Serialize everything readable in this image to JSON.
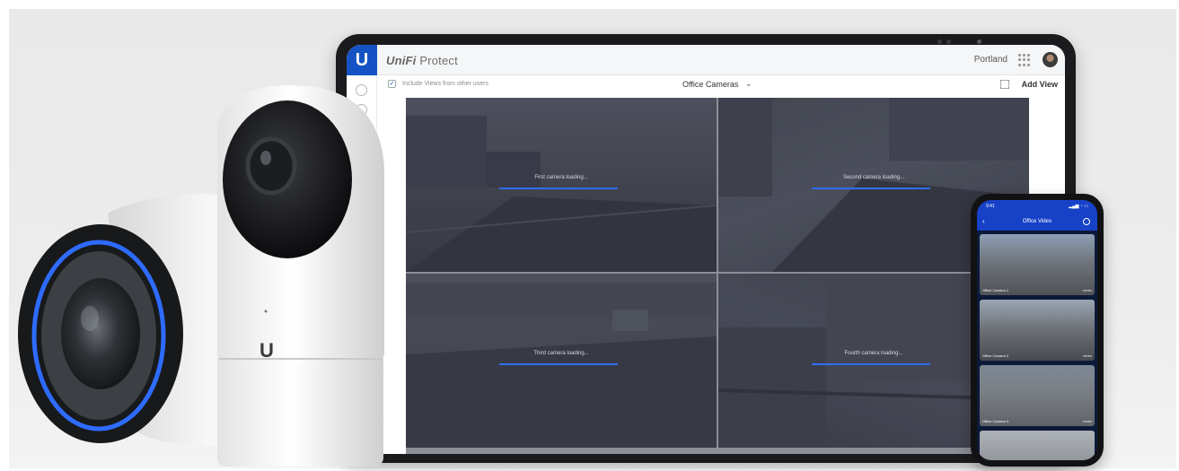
{
  "tablet": {
    "app": {
      "brand": "UniFi",
      "product": "Protect",
      "logo_letter": "U"
    },
    "site_name": "Portland",
    "toolbar": {
      "include_views_label": "Include Views from other users",
      "include_views_checked": true,
      "view_name": "Office Cameras",
      "add_view_label": "Add View"
    },
    "feeds": [
      {
        "caption": "First camera loading..."
      },
      {
        "caption": "Second camera loading..."
      },
      {
        "caption": "Third camera loading..."
      },
      {
        "caption": "Fourth camera loading..."
      }
    ]
  },
  "phone": {
    "status_time": "9:41",
    "status_right": "▂▄▆ ◔ ▭",
    "title": "Office Video",
    "thumbs": [
      {
        "left": "Office Camera 1",
        "right": "▪▪▪▪▪▪▪"
      },
      {
        "left": "Office Camera 2",
        "right": "▪▪▪▪▪▪▪"
      },
      {
        "left": "Office Camera 3",
        "right": "▪▪▪▪▪▪▪"
      },
      {
        "left": "",
        "right": ""
      }
    ]
  },
  "hardware": {
    "camera_logo_letter": "U"
  },
  "colors": {
    "accent": "#1553c4",
    "progress": "#2f6df2",
    "ring": "#2e6bff"
  }
}
